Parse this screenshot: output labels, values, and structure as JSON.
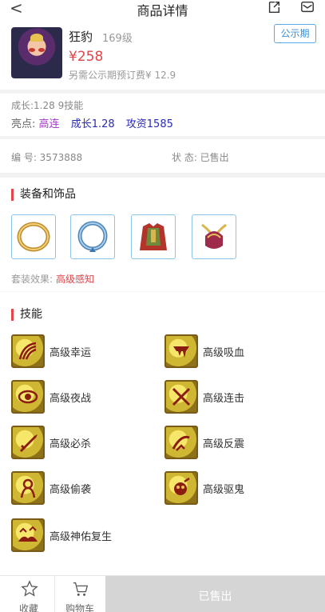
{
  "header": {
    "back_glyph": "<",
    "title": "商品详情",
    "share_icon": "share-icon",
    "mail_icon": "mail-icon"
  },
  "product": {
    "name": "狂豹",
    "level": "169级",
    "badge": "公示期",
    "price": "¥258",
    "fee": "另需公示期预订费¥ 12.9",
    "accent_color": "#e2454a"
  },
  "attributes": {
    "growth_text": "成长:1.28 9技能",
    "highlights_label": "亮点:",
    "highlights": [
      "高连",
      "成长1.28",
      "攻资1585"
    ]
  },
  "ids": {
    "number": "编 号:  3573888",
    "status": "状 态:  已售出"
  },
  "equipment": {
    "title": "装备和饰品",
    "items": [
      "ring-icon",
      "bracelet-icon",
      "armor-icon",
      "helmet-icon"
    ],
    "set_effect_label": "套装效果:",
    "set_effect_value": "高级感知"
  },
  "skills": {
    "title": "技能",
    "items": [
      {
        "name": "高级幸运",
        "icon": "luck-icon"
      },
      {
        "name": "高级吸血",
        "icon": "vampire-icon"
      },
      {
        "name": "高级夜战",
        "icon": "night-battle-icon"
      },
      {
        "name": "高级连击",
        "icon": "combo-icon"
      },
      {
        "name": "高级必杀",
        "icon": "critical-icon"
      },
      {
        "name": "高级反震",
        "icon": "counter-icon"
      },
      {
        "name": "高级偷袭",
        "icon": "sneak-attack-icon"
      },
      {
        "name": "高级驱鬼",
        "icon": "exorcism-icon"
      },
      {
        "name": "高级神佑复生",
        "icon": "divine-revive-icon"
      }
    ]
  },
  "bottom_bar": {
    "favorite_label": "收藏",
    "cart_label": "购物车",
    "sold_label": "已售出"
  }
}
